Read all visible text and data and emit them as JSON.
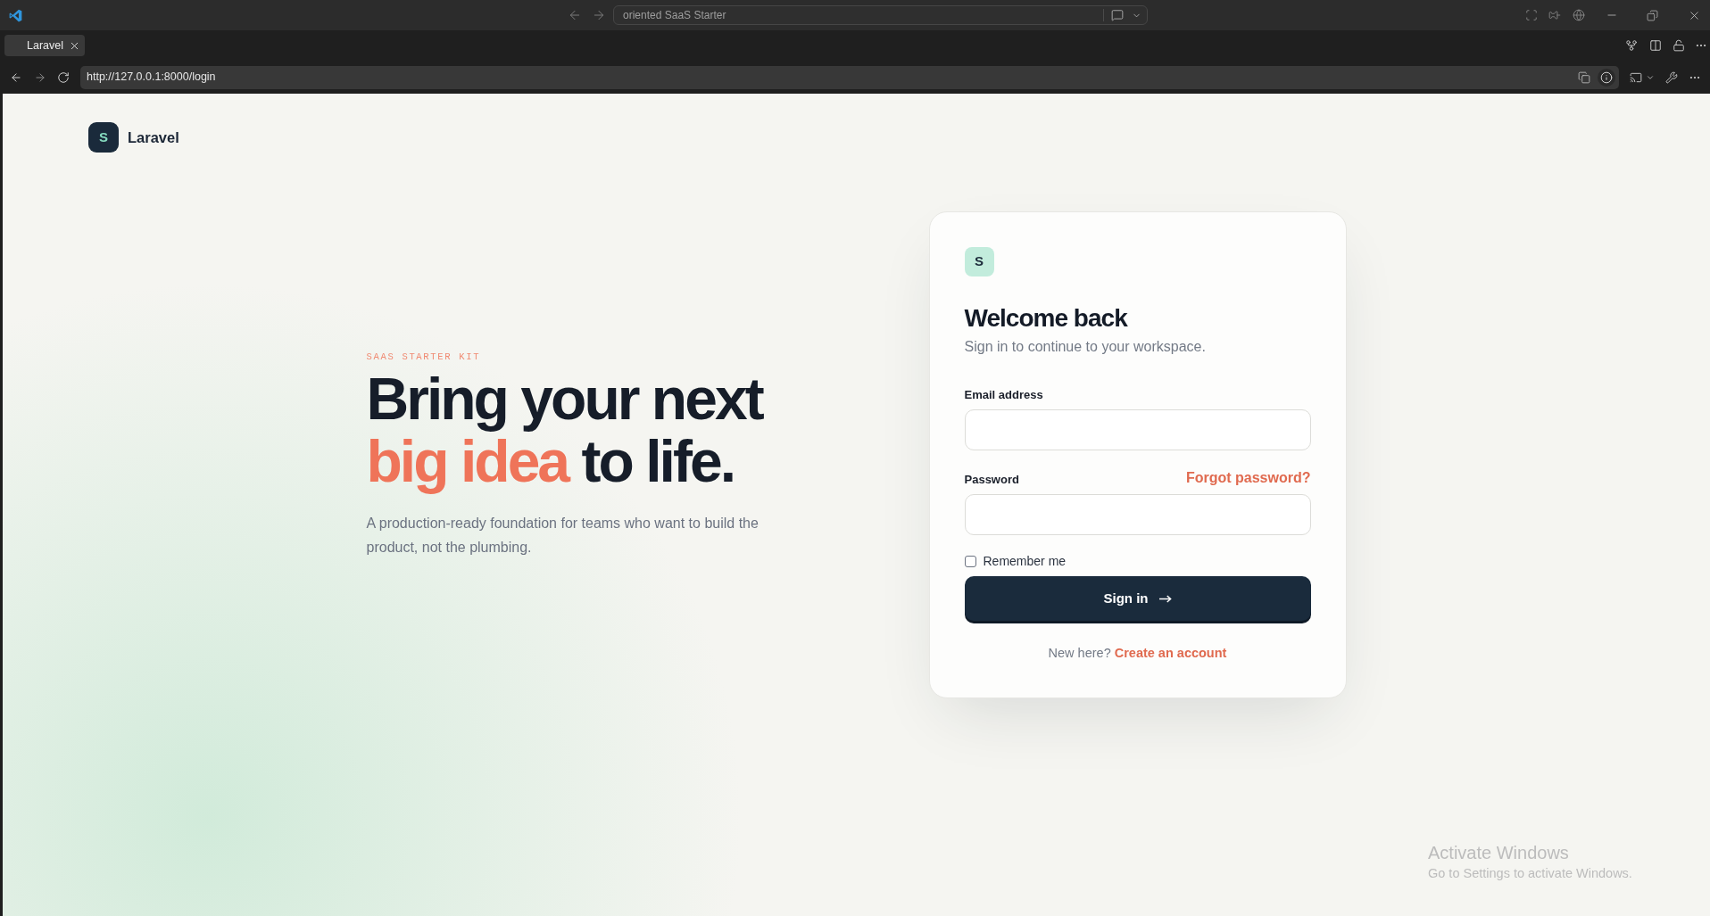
{
  "window": {
    "title": "oriented SaaS Starter"
  },
  "tabs": [
    {
      "label": "Laravel",
      "selected": true
    }
  ],
  "address_bar": {
    "url": "http://127.0.0.1:8000/login"
  },
  "brand": {
    "mark": "S",
    "name": "Laravel"
  },
  "hero": {
    "eyebrow": "SAAS STARTER KIT",
    "headline": [
      {
        "text": "Bring your next",
        "accent": false
      },
      {
        "text": "big idea",
        "accent": true
      },
      {
        "text": "to life.",
        "accent": false
      }
    ],
    "description": "A production-ready foundation for teams who want to build the product, not the plumbing."
  },
  "login_card": {
    "mark": "S",
    "title": "Welcome back",
    "subtitle": "Sign in to continue to your workspace.",
    "fields": [
      {
        "label": "Email address"
      },
      {
        "label": "Password",
        "link": "Forgot password?"
      }
    ],
    "remember": {
      "label": "Remember me",
      "checked": false
    },
    "submit": "Sign in",
    "footer": {
      "prompt": "New here?",
      "link": "Create an account"
    }
  },
  "os_notice": {
    "title": "Activate Windows",
    "text": "Go to Settings to activate Windows."
  }
}
